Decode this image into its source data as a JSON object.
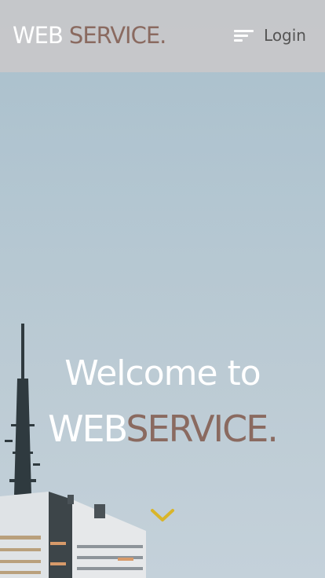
{
  "header": {
    "logo_web": "WEB",
    "logo_service": "SERVICE",
    "logo_dot": ".",
    "login_label": "Login"
  },
  "hero": {
    "welcome_line": "Welcome to",
    "brand_web": "WEB",
    "brand_service": "SERVICE",
    "brand_dot": "."
  },
  "icons": {
    "menu": "hamburger-menu-icon",
    "scroll": "chevron-down-icon"
  },
  "colors": {
    "accent_brown": "#8a6a60",
    "chevron_yellow": "#d9b52a",
    "header_bg": "#c8c8ca",
    "sky": "#b3c6d1"
  }
}
